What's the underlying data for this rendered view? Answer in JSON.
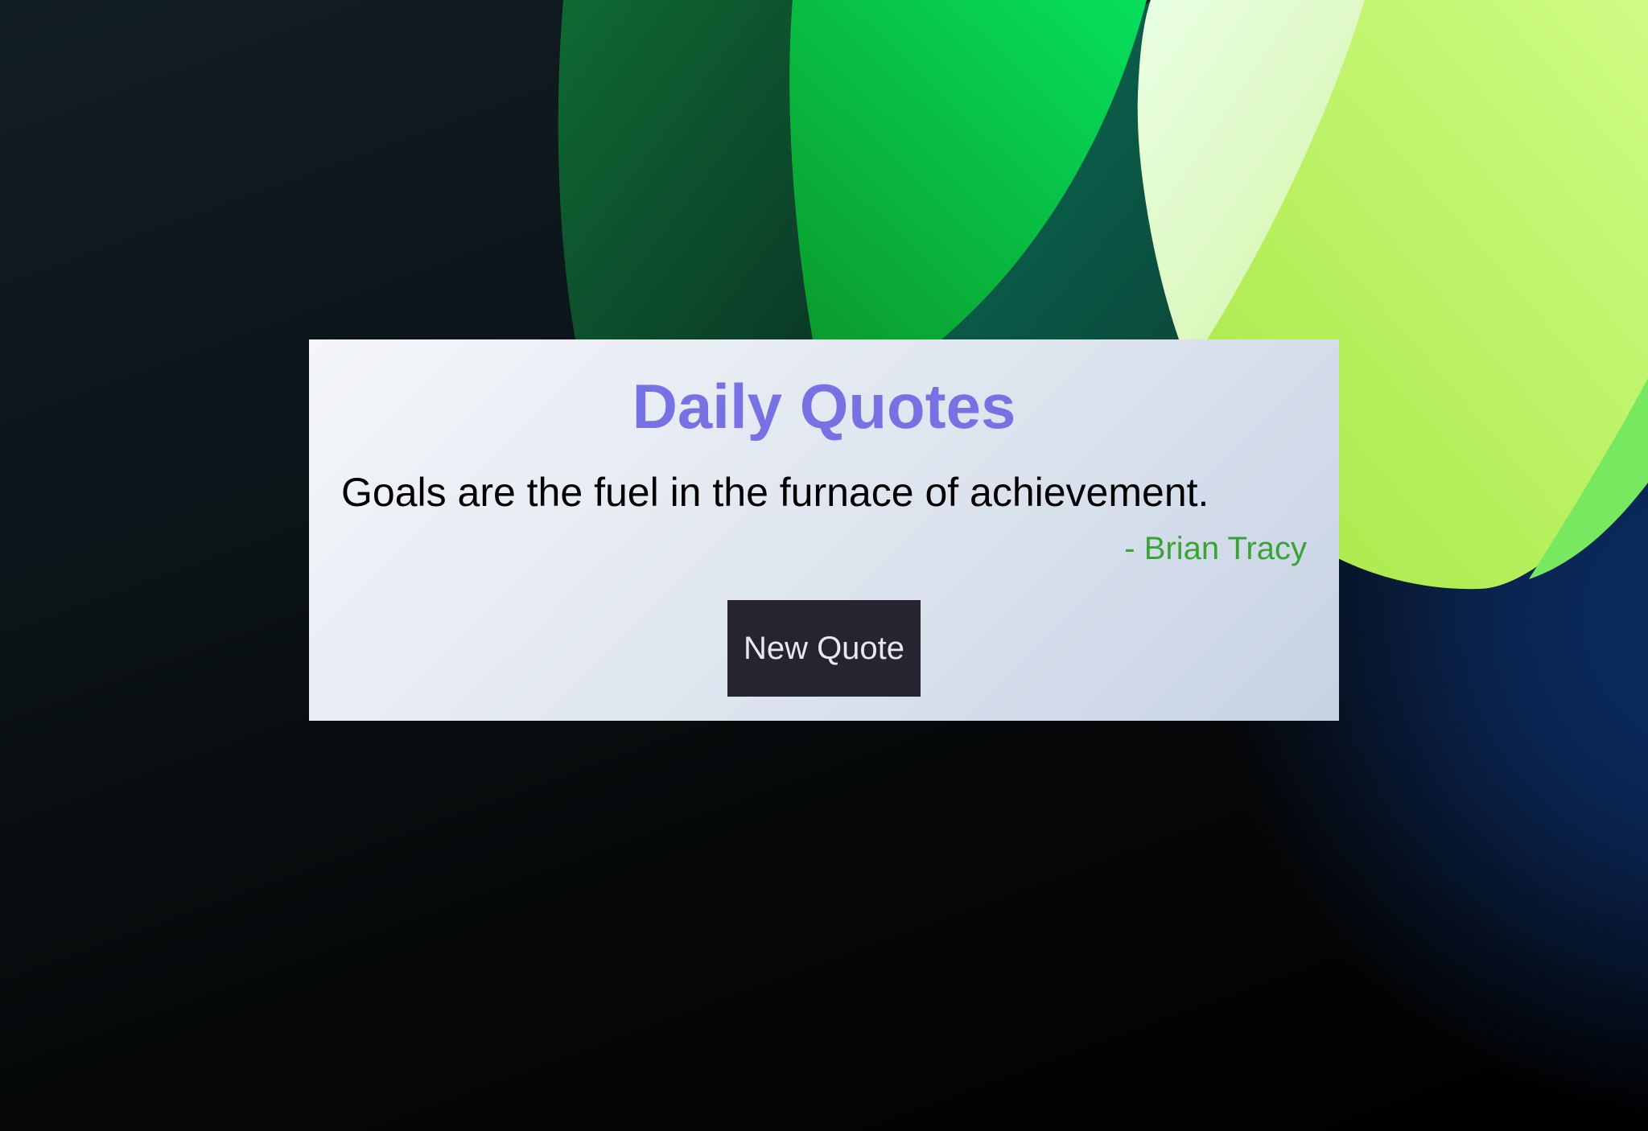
{
  "app": {
    "title": "Daily Quotes"
  },
  "quote": {
    "text": "Goals are the fuel in the furnace of achievement.",
    "author": "- Brian Tracy"
  },
  "controls": {
    "new_quote_label": "New Quote"
  },
  "colors": {
    "title": "#7772e3",
    "author": "#3aa336",
    "button_bg": "#272432",
    "button_text": "#e8e8ee",
    "quote_text": "#000000"
  }
}
